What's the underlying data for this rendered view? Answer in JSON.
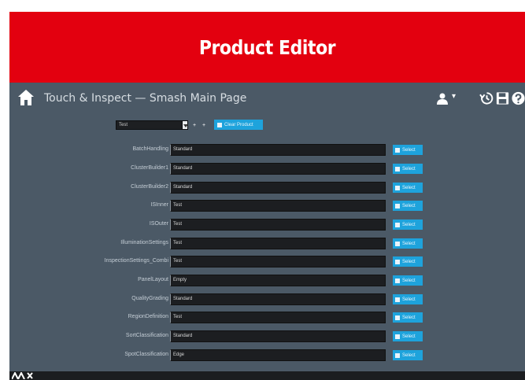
{
  "banner": {
    "title": "Product Editor",
    "color": "#e3000f"
  },
  "app": {
    "title": "Touch & Inspect — Smash Main Page",
    "background": "#4b5966",
    "icons": {
      "home": "home-icon",
      "user": "user-icon",
      "user_caret": "▾",
      "history": "history-icon",
      "save": "save-icon",
      "help": "help-icon"
    }
  },
  "toolbar": {
    "product_value": "Test",
    "add_symbol": "+",
    "remove_symbol": "+",
    "clear_label": "Clear Product"
  },
  "accent": "#1ea3dc",
  "rows": [
    {
      "label": "BatchHandling",
      "value": "Standard",
      "button": "Select"
    },
    {
      "label": "ClusterBuilder1",
      "value": "Standard",
      "button": "Select"
    },
    {
      "label": "ClusterBuilder2",
      "value": "Standard",
      "button": "Select"
    },
    {
      "label": "ISInner",
      "value": "Test",
      "button": "Select"
    },
    {
      "label": "ISOuter",
      "value": "Test",
      "button": "Select"
    },
    {
      "label": "IlluminationSettings",
      "value": "Test",
      "button": "Select"
    },
    {
      "label": "InspectionSettings_Combi",
      "value": "Test",
      "button": "Select"
    },
    {
      "label": "PanelLayout",
      "value": "Empty",
      "button": "Select"
    },
    {
      "label": "QualityGrading",
      "value": "Standard",
      "button": "Select"
    },
    {
      "label": "RegionDefinition",
      "value": "Test",
      "button": "Select"
    },
    {
      "label": "SortClassification",
      "value": "Standard",
      "button": "Select"
    },
    {
      "label": "SpotClassification",
      "value": "Edge",
      "button": "Select"
    }
  ]
}
